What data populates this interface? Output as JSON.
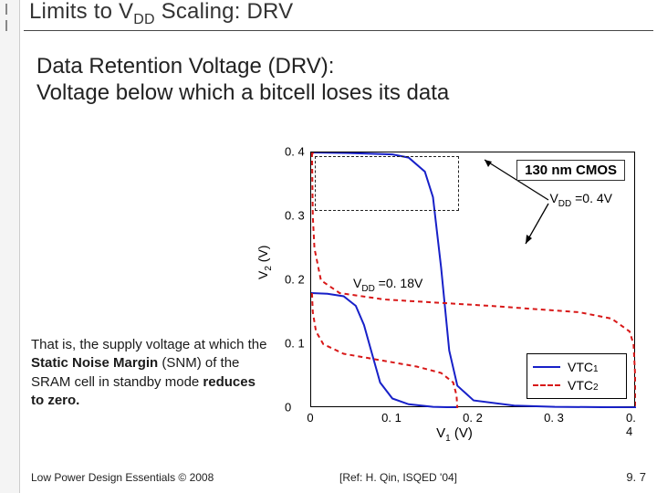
{
  "header": {
    "title_pre": "Limits to V",
    "title_sub": "DD",
    "title_post": " Scaling: DRV"
  },
  "lead": {
    "l1": "Data Retention Voltage (DRV):",
    "l2": "Voltage below which a bitcell loses its data"
  },
  "side_note": "That is, the supply voltage at which the <b>Static Noise Margin</b> (SNM) of the SRAM cell in standby mode <b>reduces to zero.</b>",
  "footer": {
    "left": "Low Power Design Essentials © 2008",
    "ref": "[Ref: H. Qin, ISQED '04]",
    "right": "9. 7"
  },
  "chart": {
    "note": "130 nm CMOS",
    "anno_vdd_hi_pre": "V",
    "anno_vdd_hi_sub": "DD",
    "anno_vdd_hi_post": " =0. 4V",
    "anno_vdd_lo_pre": "V",
    "anno_vdd_lo_sub": "DD",
    "anno_vdd_lo_post": " =0. 18V",
    "ylabel_pre": "V",
    "ylabel_sub": "2",
    "ylabel_post": " (V)",
    "xlabel_pre": "V",
    "xlabel_sub": "1",
    "xlabel_post": " (V)",
    "yticks": [
      "0",
      "0. 1",
      "0. 2",
      "0. 3",
      "0. 4"
    ],
    "xticks": [
      "0",
      "0. 1",
      "0. 2",
      "0. 3",
      "0. 4"
    ],
    "legend": [
      {
        "style": "solid",
        "pre": "VTC",
        "sub": "1"
      },
      {
        "style": "dashed",
        "pre": "VTC",
        "sub": "2"
      }
    ]
  },
  "chart_data": {
    "type": "line",
    "title": "SRAM bitcell VTC butterfly curves at two supply voltages",
    "xlabel": "V1 (V)",
    "ylabel": "V2 (V)",
    "xlim": [
      0,
      0.4
    ],
    "ylim": [
      0,
      0.4
    ],
    "annotations": [
      "130 nm CMOS",
      "V_DD = 0.4 V",
      "V_DD = 0.18 V"
    ],
    "series": [
      {
        "name": "VTC1 (VDD=0.4V)",
        "color": "#1720c8",
        "style": "solid",
        "x": [
          0.0,
          0.05,
          0.1,
          0.12,
          0.14,
          0.15,
          0.16,
          0.17,
          0.18,
          0.2,
          0.25,
          0.3,
          0.4
        ],
        "y": [
          0.4,
          0.399,
          0.397,
          0.392,
          0.37,
          0.33,
          0.22,
          0.09,
          0.035,
          0.012,
          0.004,
          0.002,
          0.001
        ]
      },
      {
        "name": "VTC2 (VDD=0.4V)",
        "color": "#d81818",
        "style": "dashed",
        "x": [
          0.001,
          0.002,
          0.004,
          0.012,
          0.035,
          0.09,
          0.22,
          0.33,
          0.37,
          0.392,
          0.397,
          0.399,
          0.4
        ],
        "y": [
          0.4,
          0.3,
          0.25,
          0.2,
          0.18,
          0.17,
          0.16,
          0.15,
          0.14,
          0.12,
          0.1,
          0.05,
          0.0
        ]
      },
      {
        "name": "VTC1 (VDD=0.18V)",
        "color": "#1720c8",
        "style": "solid",
        "x": [
          0.0,
          0.02,
          0.04,
          0.055,
          0.065,
          0.075,
          0.085,
          0.1,
          0.12,
          0.15,
          0.18
        ],
        "y": [
          0.18,
          0.179,
          0.175,
          0.16,
          0.13,
          0.085,
          0.04,
          0.015,
          0.006,
          0.002,
          0.001
        ]
      },
      {
        "name": "VTC2 (VDD=0.18V)",
        "color": "#d81818",
        "style": "dashed",
        "x": [
          0.001,
          0.002,
          0.006,
          0.015,
          0.04,
          0.085,
          0.13,
          0.16,
          0.175,
          0.179,
          0.18
        ],
        "y": [
          0.18,
          0.15,
          0.12,
          0.1,
          0.085,
          0.075,
          0.065,
          0.055,
          0.04,
          0.02,
          0.0
        ]
      }
    ]
  }
}
